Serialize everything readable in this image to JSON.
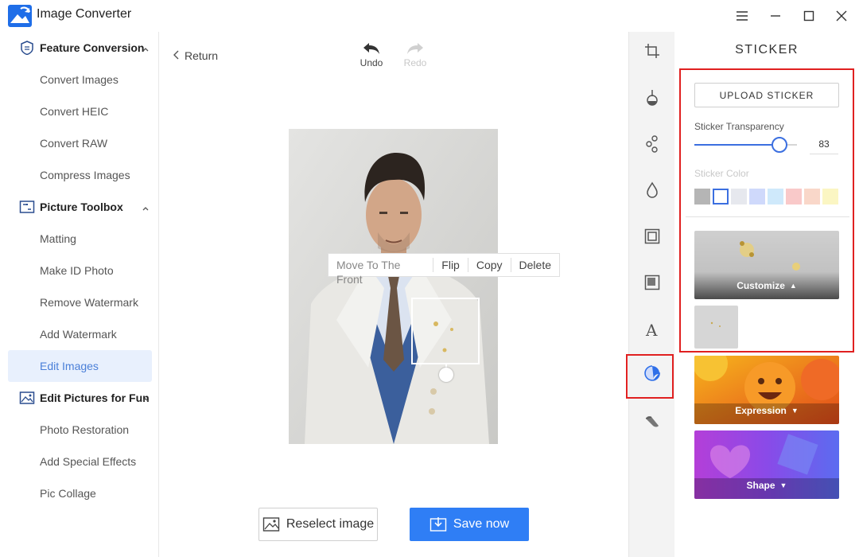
{
  "app": {
    "title": "Image Converter"
  },
  "window_controls": [
    "menu-icon",
    "minimize-icon",
    "maximize-icon",
    "close-icon"
  ],
  "sidebar": {
    "groups": [
      {
        "label": "Feature Conversion",
        "icon": "conversion-icon",
        "items": [
          {
            "label": "Convert Images"
          },
          {
            "label": "Convert HEIC"
          },
          {
            "label": "Convert RAW"
          },
          {
            "label": "Compress Images"
          }
        ]
      },
      {
        "label": "Picture Toolbox",
        "icon": "toolbox-icon",
        "items": [
          {
            "label": "Matting"
          },
          {
            "label": "Make ID Photo"
          },
          {
            "label": "Remove Watermark"
          },
          {
            "label": "Add Watermark"
          },
          {
            "label": "Edit Images",
            "active": true
          }
        ]
      },
      {
        "label": "Edit Pictures for Fun",
        "icon": "fun-pictures-icon",
        "items": [
          {
            "label": "Photo Restoration"
          },
          {
            "label": "Add Special Effects"
          },
          {
            "label": "Pic Collage"
          }
        ]
      }
    ]
  },
  "editor": {
    "return_label": "Return",
    "undo_label": "Undo",
    "redo_label": "Redo",
    "context_menu": [
      "Move To The Front",
      "Flip",
      "Copy",
      "Delete"
    ],
    "reselect_label": "Reselect image",
    "save_label": "Save now"
  },
  "tools": [
    "crop-icon",
    "adjust-icon",
    "filter-icon",
    "drop-icon",
    "frame-icon",
    "border-icon",
    "text-icon",
    "sticker-icon",
    "brush-icon"
  ],
  "sticker_panel": {
    "title": "STICKER",
    "upload_label": "UPLOAD STICKER",
    "transparency_label": "Sticker Transparency",
    "transparency_value": "83",
    "transparency_fraction": 0.83,
    "color_label": "Sticker Color",
    "colors": [
      "#b5b5b5",
      "#ffffff",
      "#e6e8ee",
      "#cfd9fb",
      "#cfe9fb",
      "#f9c9c9",
      "#f9d7c9",
      "#fbf6c3"
    ],
    "categories": [
      {
        "label": "Customize",
        "arrow": "▲"
      },
      {
        "label": "Expression",
        "arrow": "▼"
      },
      {
        "label": "Shape",
        "arrow": "▼"
      }
    ]
  },
  "colors": {
    "accent": "#2f7ef5",
    "highlight": "#e02020"
  }
}
